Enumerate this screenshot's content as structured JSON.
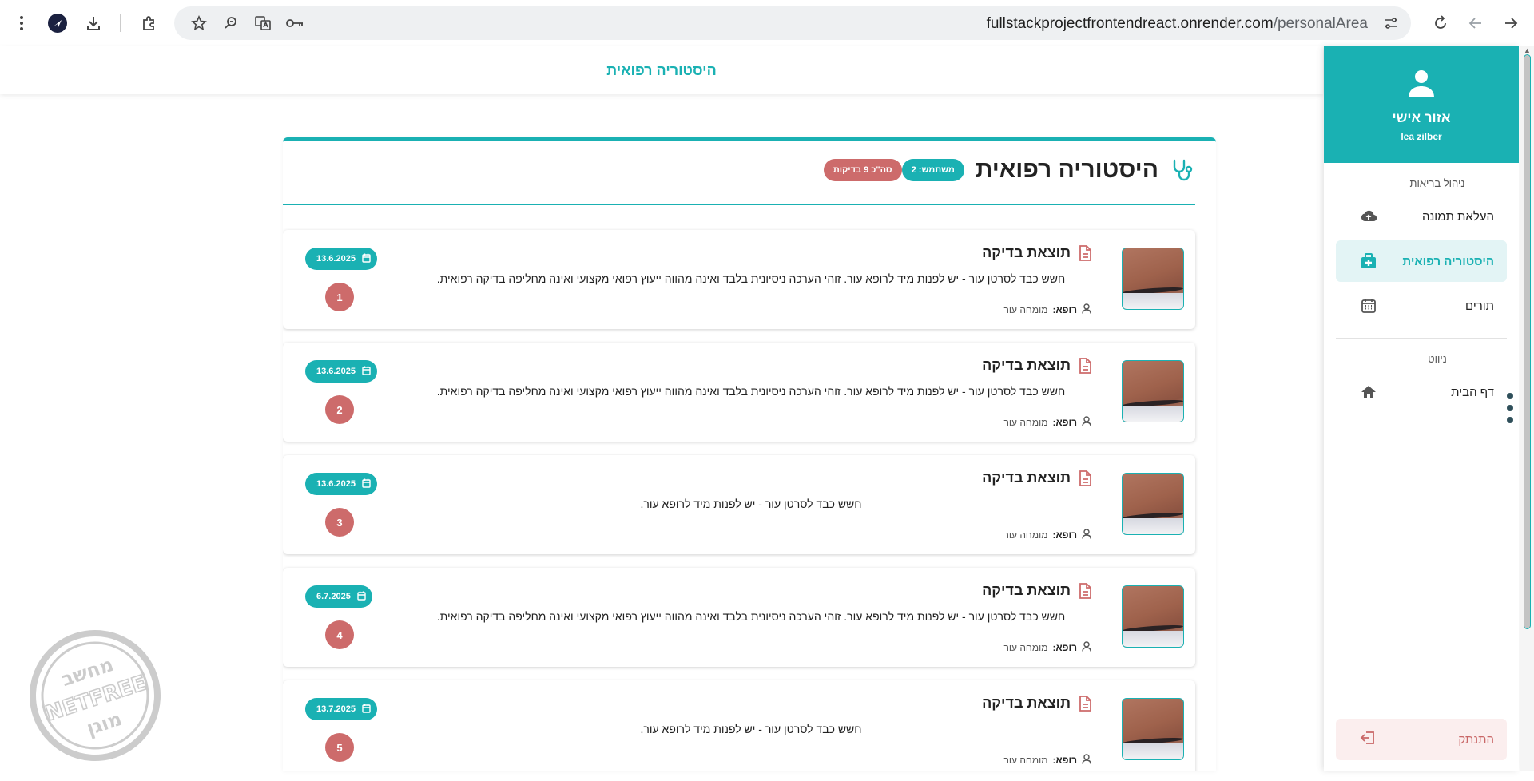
{
  "browser": {
    "url_host": "fullstackprojectfrontendreact.onrender.com",
    "url_path": "/personalArea"
  },
  "topbar": {
    "title": "היסטוריה רפואית"
  },
  "sidebar": {
    "header_title": "אזור אישי",
    "username": "lea zilber",
    "section_health": "ניהול בריאות",
    "items": [
      {
        "label": "העלאת תמונה",
        "icon": "cloud-upload-icon"
      },
      {
        "label": "היסטוריה רפואית",
        "icon": "medical-bag-icon"
      },
      {
        "label": "תורים",
        "icon": "calendar-icon"
      }
    ],
    "section_nav": "ניווט",
    "nav_items": [
      {
        "label": "דף הבית",
        "icon": "home-icon"
      }
    ],
    "logout_label": "התנתק"
  },
  "main": {
    "title": "היסטוריה רפואית",
    "user_badge": "משתמש: 2",
    "total_badge": "סה\"כ 9 בדיקות",
    "doctor_label": "רופא:",
    "records": [
      {
        "title": "תוצאת בדיקה",
        "text": "חשש כבד לסרטן עור - יש לפנות מיד לרופא עור. זוהי הערכה ניסיונית בלבד ואינה מהווה ייעוץ רפואי מקצועי ואינה מחליפה בדיקה רפואית.",
        "doctor": "מומחה עור",
        "date": "13.6.2025",
        "num": "1"
      },
      {
        "title": "תוצאת בדיקה",
        "text": "חשש כבד לסרטן עור - יש לפנות מיד לרופא עור. זוהי הערכה ניסיונית בלבד ואינה מהווה ייעוץ רפואי מקצועי ואינה מחליפה בדיקה רפואית.",
        "doctor": "מומחה עור",
        "date": "13.6.2025",
        "num": "2"
      },
      {
        "title": "תוצאת בדיקה",
        "text": "חשש כבד לסרטן עור - יש לפנות מיד לרופא עור.",
        "doctor": "מומחה עור",
        "date": "13.6.2025",
        "num": "3"
      },
      {
        "title": "תוצאת בדיקה",
        "text": "חשש כבד לסרטן עור - יש לפנות מיד לרופא עור. זוהי הערכה ניסיונית בלבד ואינה מהווה ייעוץ רפואי מקצועי ואינה מחליפה בדיקה רפואית.",
        "doctor": "מומחה עור",
        "date": "6.7.2025",
        "num": "4"
      },
      {
        "title": "תוצאת בדיקה",
        "text": "חשש כבד לסרטן עור - יש לפנות מיד לרופא עור.",
        "doctor": "מומחה עור",
        "date": "13.7.2025",
        "num": "5"
      }
    ]
  },
  "watermark": {
    "top": "מחשב",
    "middle": "NETFREE",
    "bottom": "מוגן"
  },
  "colors": {
    "accent": "#1ab1b3",
    "danger": "#cd6b6b"
  }
}
